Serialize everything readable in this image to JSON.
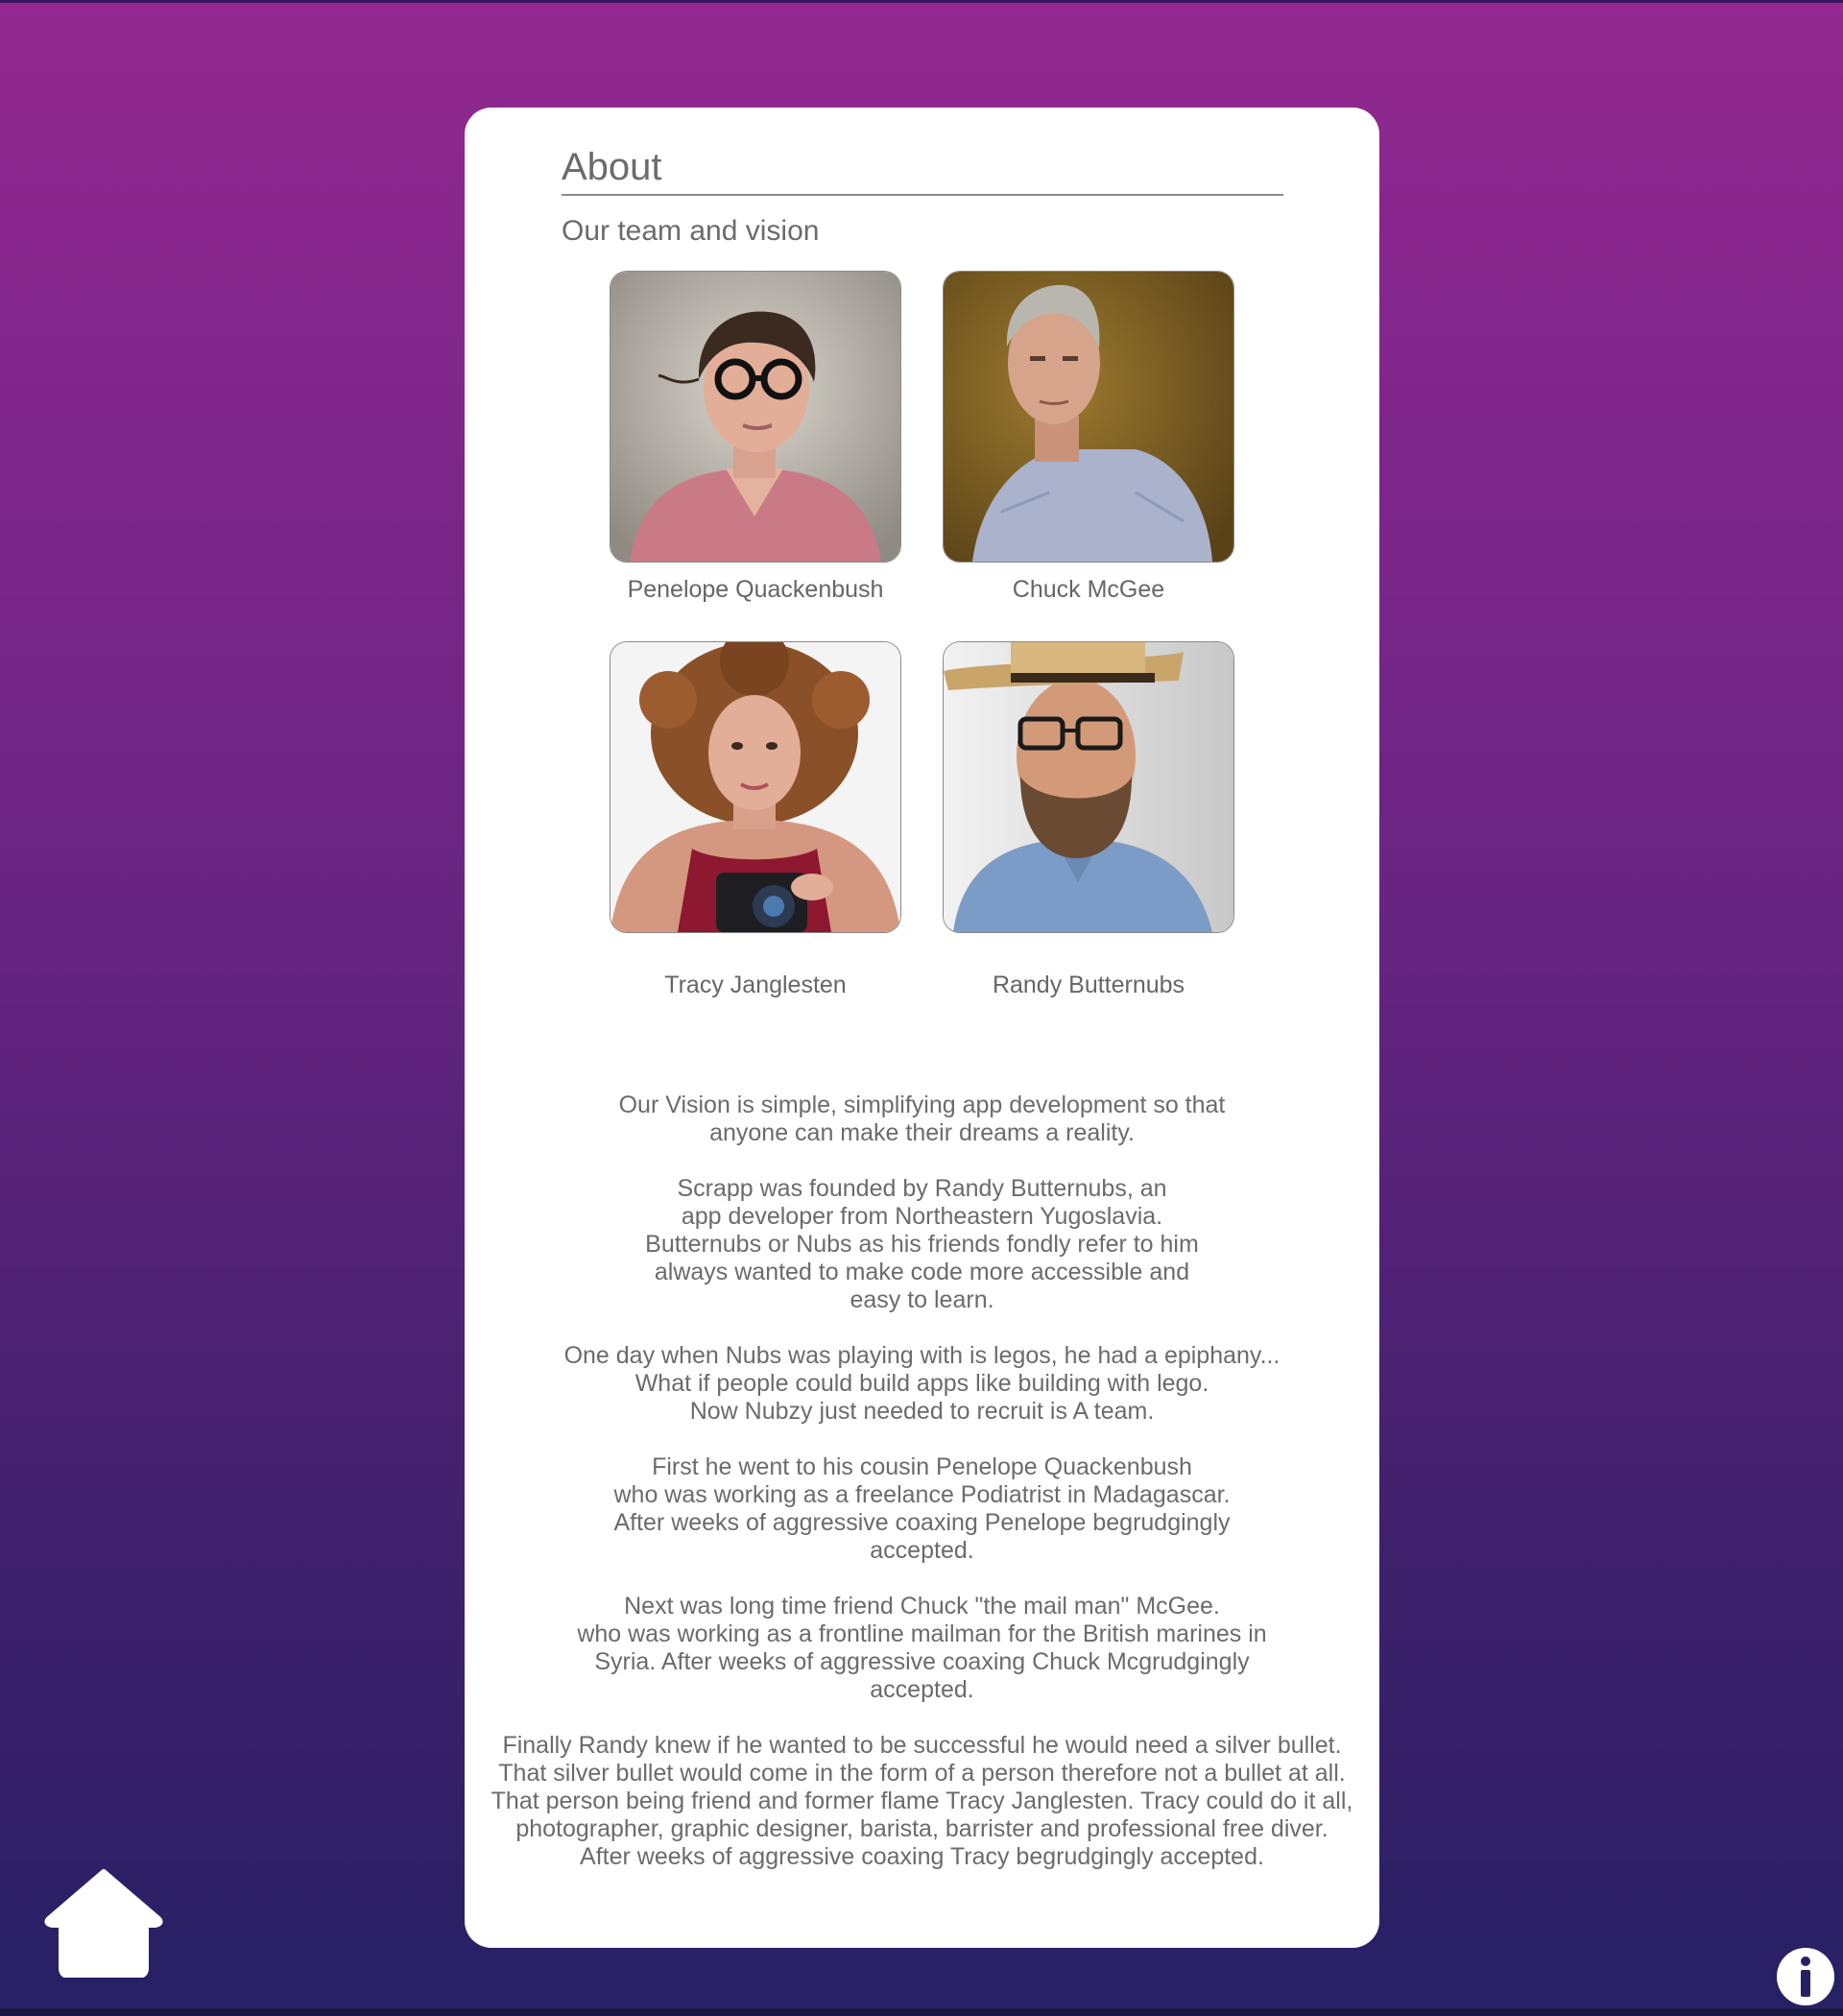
{
  "page": {
    "title": "About",
    "subtitle": "Our team and vision"
  },
  "team": [
    {
      "name": "Penelope Quackenbush",
      "photo": "portrait-woman-glasses"
    },
    {
      "name": "Chuck McGee",
      "photo": "portrait-older-man"
    },
    {
      "name": "Tracy Janglesten",
      "photo": "portrait-woman-camera"
    },
    {
      "name": "Randy Butternubs",
      "photo": "portrait-man-hat"
    }
  ],
  "vision": {
    "paragraphs": [
      "Our Vision is simple, simplifying app development so that\nanyone can make their dreams a reality.",
      "Scrapp was founded by Randy Butternubs, an\napp developer from Northeastern Yugoslavia.\nButternubs or Nubs as his friends fondly refer to him\nalways wanted to make code more accessible and\neasy to learn.",
      "One day when Nubs was playing with is legos, he had a epiphany...\nWhat if people could build apps like building with lego.\nNow Nubzy just needed to recruit is A team.",
      "First he went to his cousin Penelope Quackenbush\nwho was working as a freelance Podiatrist in Madagascar.\nAfter weeks of aggressive coaxing Penelope begrudgingly\naccepted.",
      "Next was long time friend Chuck \"the mail man\" McGee.\nwho was working as a frontline mailman for the British marines in\nSyria. After weeks of aggressive coaxing Chuck Mcgrudgingly\naccepted.",
      "Finally Randy knew if he wanted to be successful he would need a silver bullet.\nThat silver bullet would come in the form of a person therefore not a bullet at all.\nThat person being friend and former flame Tracy Janglesten. Tracy could do it all,\nphotographer, graphic designer, barista, barrister and professional free diver.\nAfter weeks of aggressive coaxing Tracy begrudgingly accepted."
    ]
  },
  "nav": {
    "home_icon": "home-icon",
    "info_icon": "info-icon"
  },
  "colors": {
    "background_top": "#922890",
    "background_bottom": "#262064",
    "card": "#ffffff",
    "text": "#6b6b6b"
  }
}
